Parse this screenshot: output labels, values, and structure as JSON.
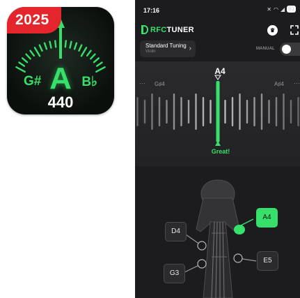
{
  "app_icon": {
    "badge": "2025",
    "note": "A",
    "flat_note": "G#",
    "sharp_note": "B♭",
    "frequency": "440"
  },
  "status_bar": {
    "time": "17:16",
    "battery": "83"
  },
  "header": {
    "logo_prefix": "RFC",
    "logo_suffix": "TUNER",
    "premium_icon": "crown-icon",
    "fullscreen_icon": "fullscreen-icon"
  },
  "tuning": {
    "title": "Standard Tuning",
    "instrument": "Violin",
    "chevron": "›"
  },
  "manual": {
    "label": "MANUAL",
    "enabled": false
  },
  "meter": {
    "current_note": "A4",
    "prev_note": "G♯4",
    "next_note": "A♯4",
    "status": "Great!",
    "more_left": "···",
    "more_right": "···"
  },
  "strings": [
    {
      "note": "D4",
      "active": false
    },
    {
      "note": "A4",
      "active": true
    },
    {
      "note": "G3",
      "active": false
    },
    {
      "note": "E5",
      "active": false
    }
  ],
  "colors": {
    "accent": "#36e06a",
    "badge_red": "#e4252b",
    "screen_bg": "#1c1c1e"
  }
}
